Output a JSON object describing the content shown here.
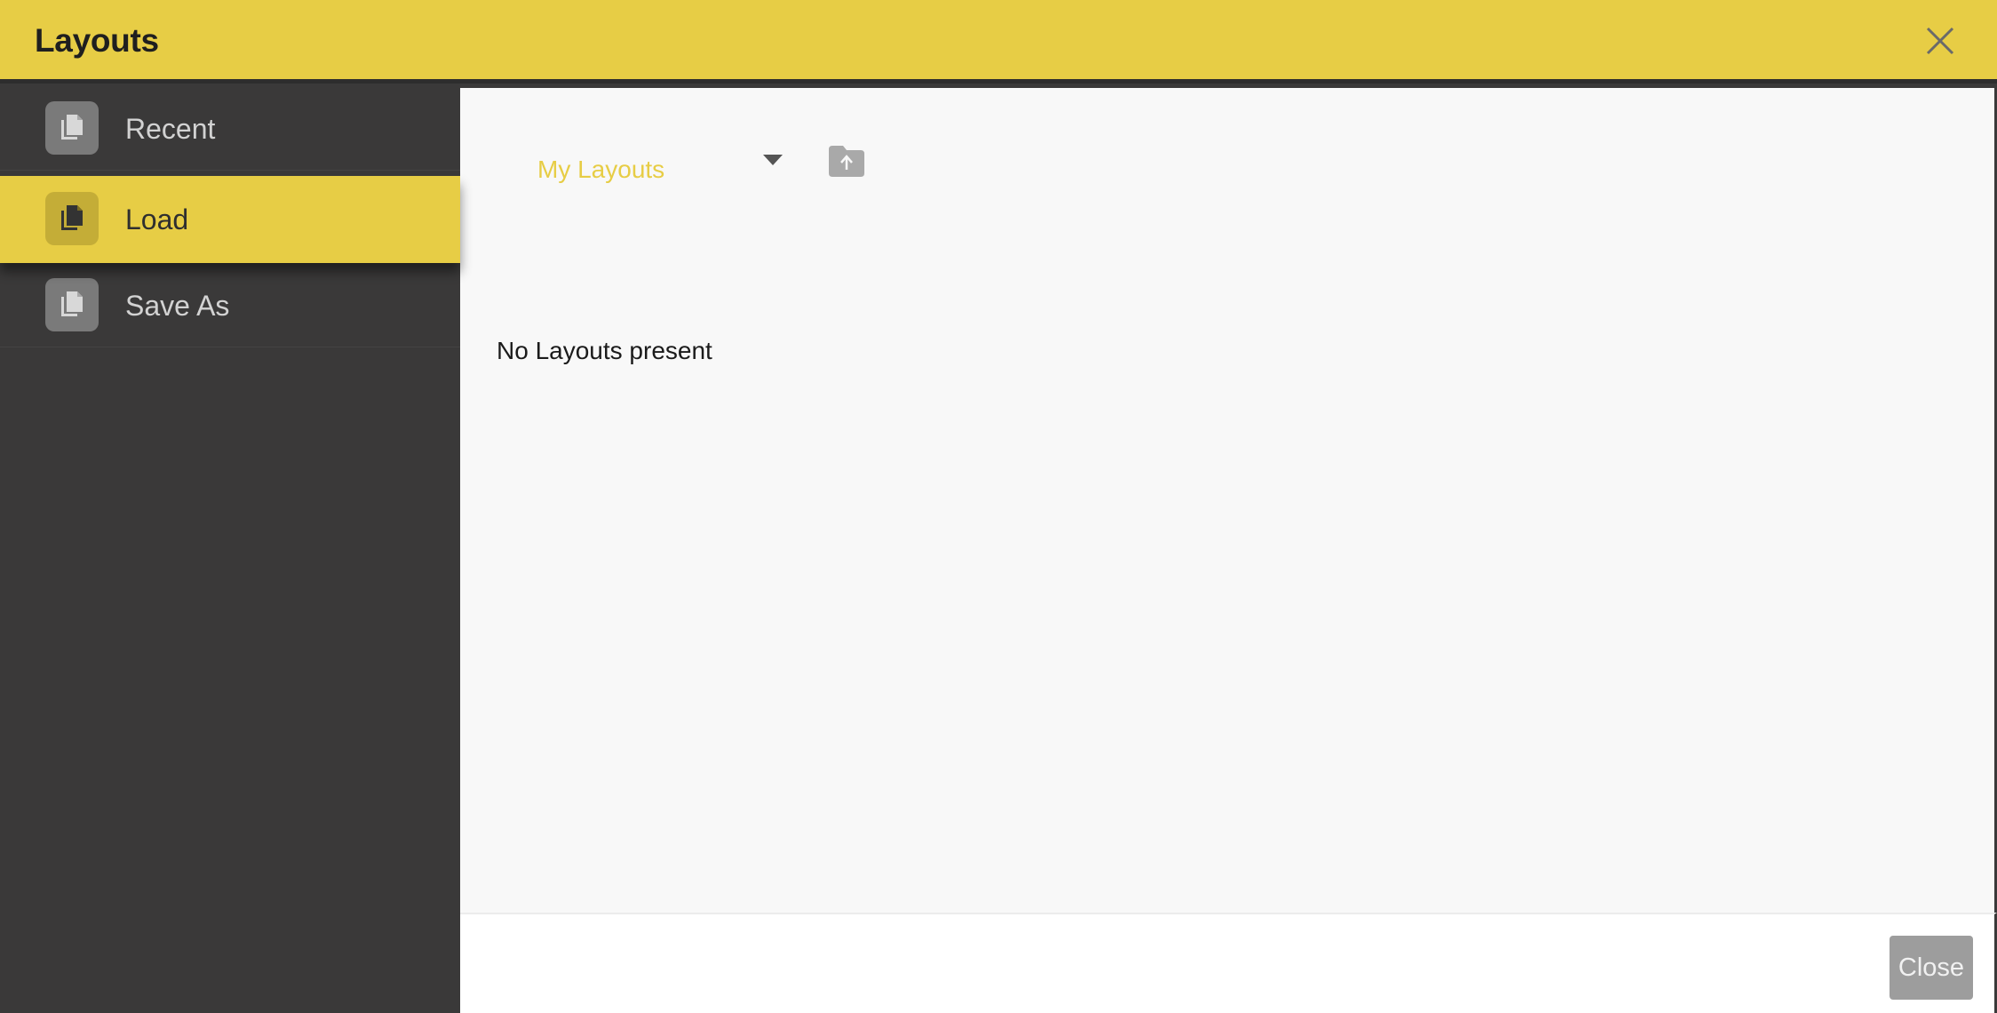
{
  "dialog": {
    "title": "Layouts",
    "close_icon": "close-x-icon",
    "accent_color": "#e7cd45"
  },
  "sidebar": {
    "items": [
      {
        "label": "Recent",
        "icon": "copy-documents-icon",
        "selected": false
      },
      {
        "label": "Load",
        "icon": "copy-documents-icon",
        "selected": true
      },
      {
        "label": "Save As",
        "icon": "copy-documents-icon",
        "selected": false
      }
    ]
  },
  "main": {
    "source_select": {
      "value": "My Layouts"
    },
    "upload_icon": "folder-upload-icon",
    "empty_message": "No Layouts present"
  },
  "footer": {
    "close_label": "Close"
  }
}
